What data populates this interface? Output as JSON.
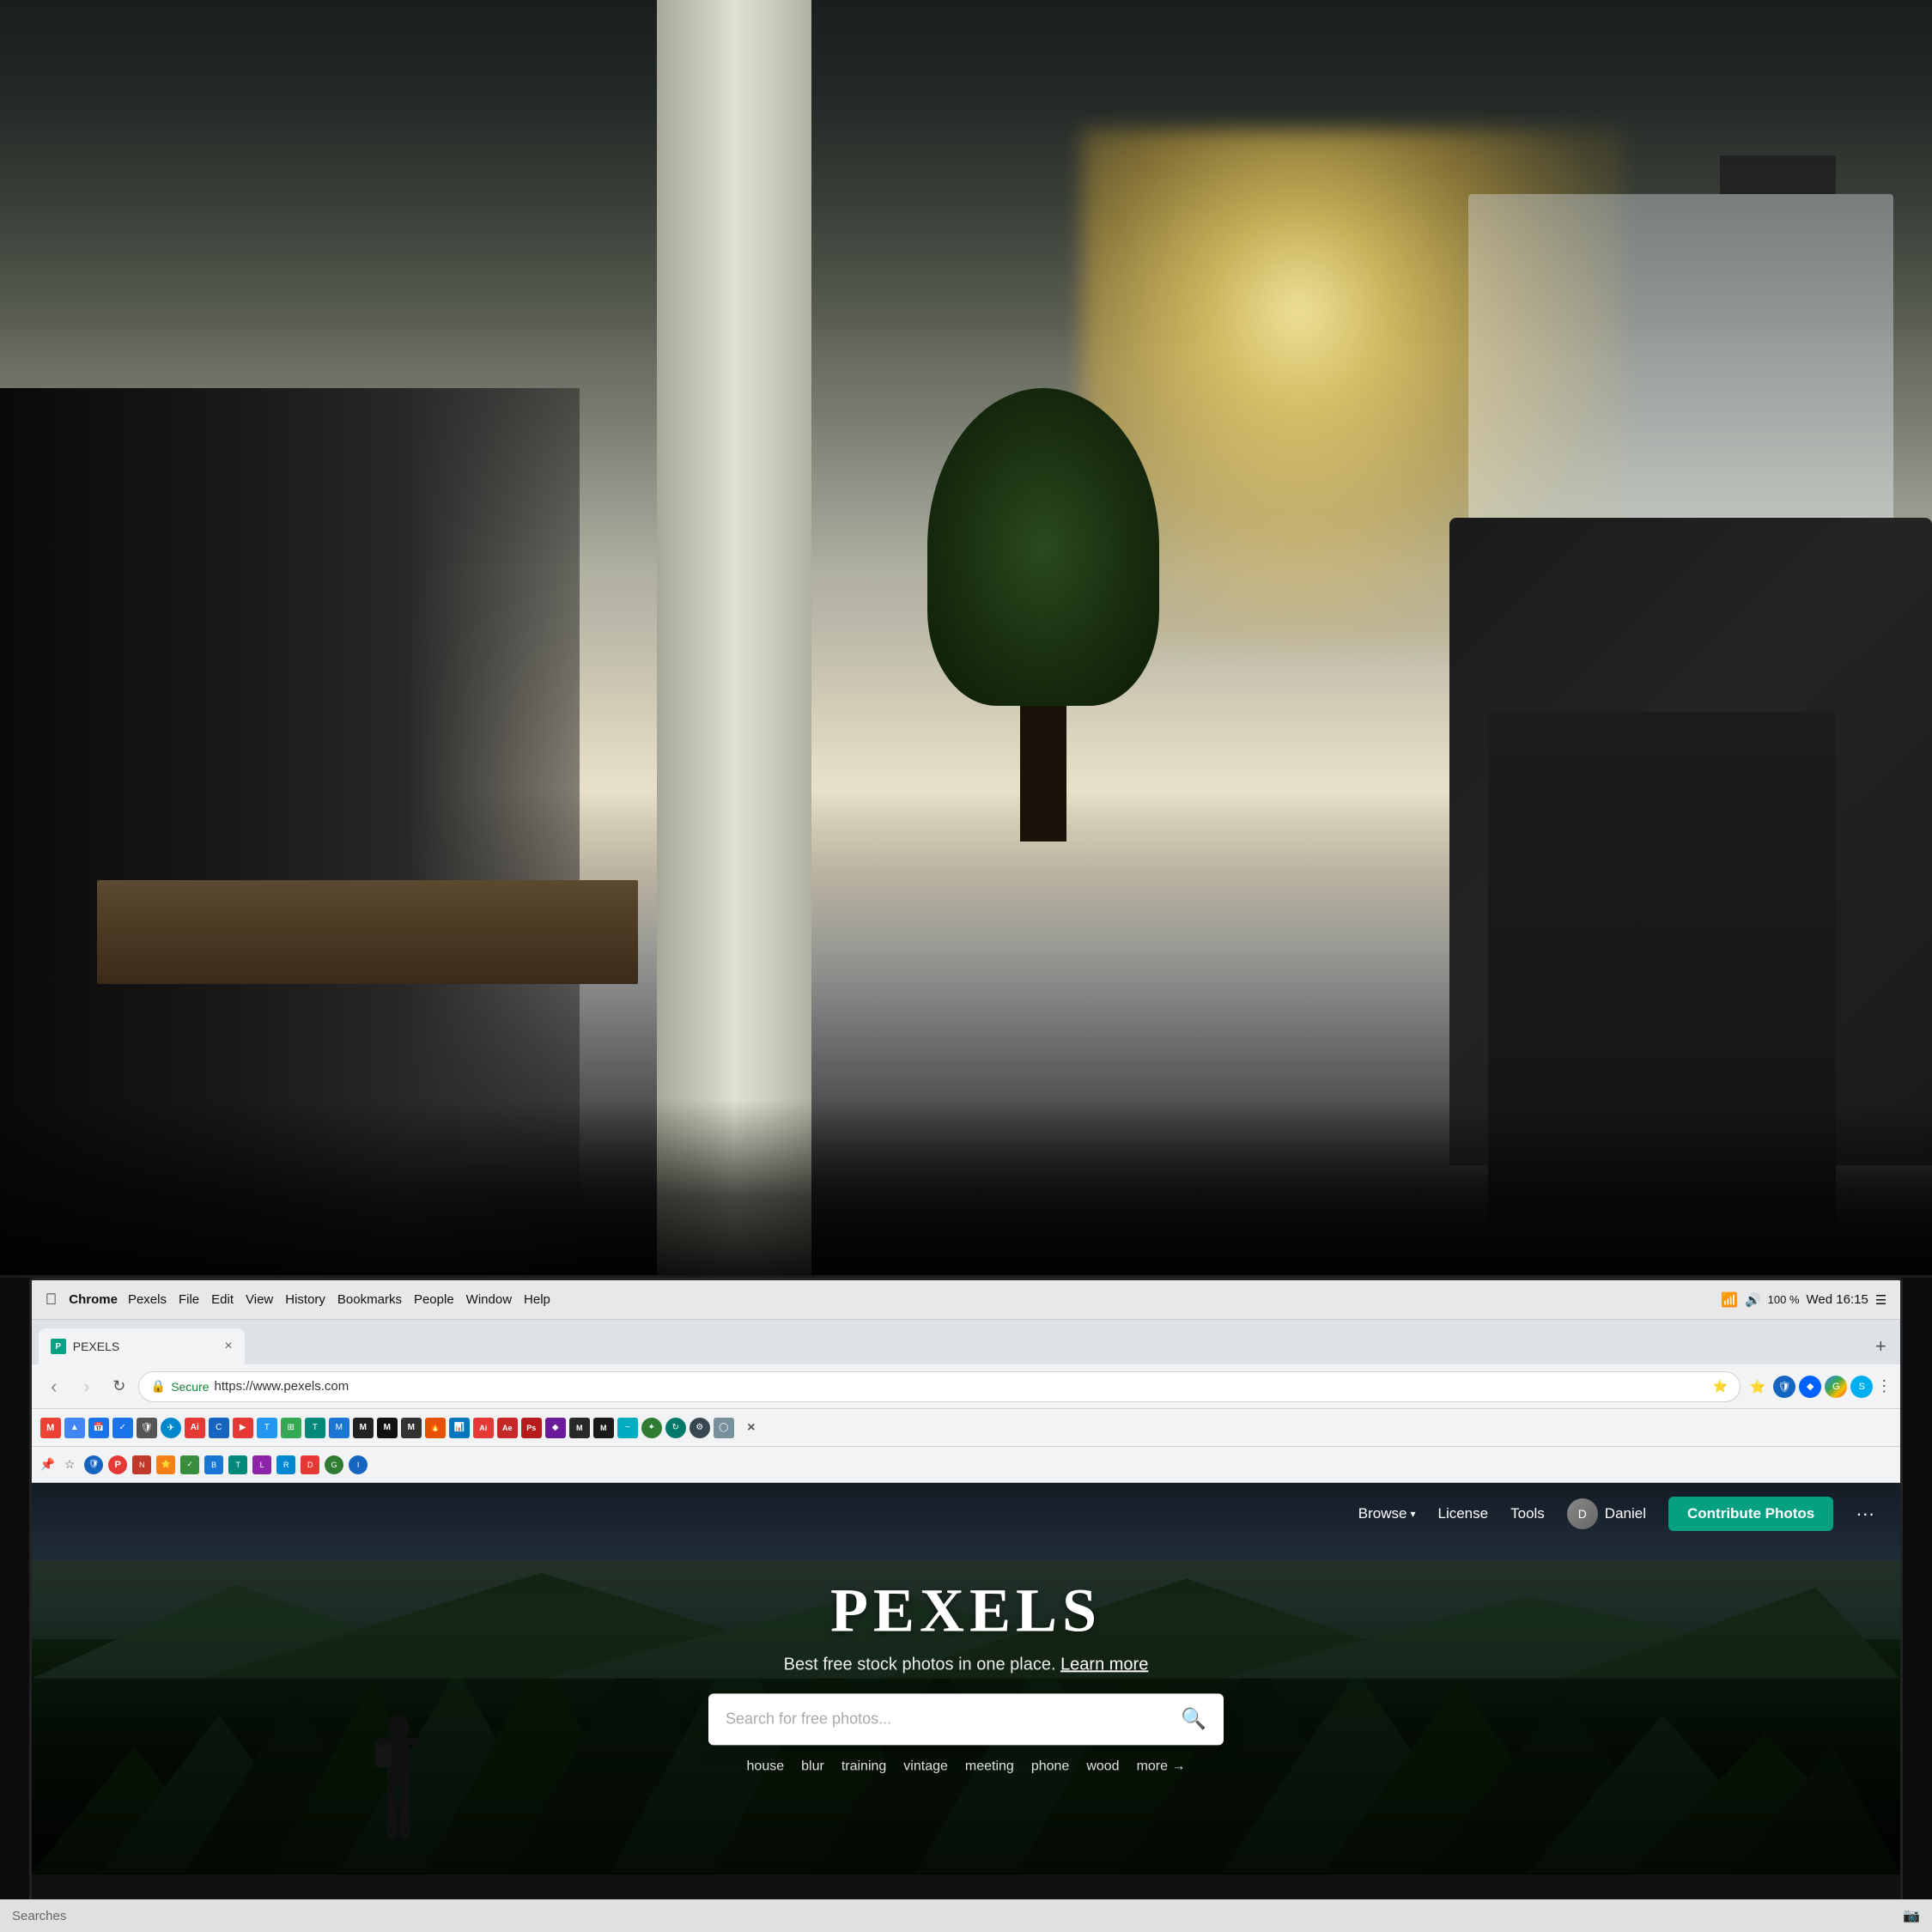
{
  "background": {
    "description": "Office interior background photo with blurred bokeh lights"
  },
  "macos": {
    "menubar": {
      "app": "Chrome",
      "menus": [
        "File",
        "Edit",
        "View",
        "History",
        "Bookmarks",
        "People",
        "Window",
        "Help"
      ],
      "time": "Wed 16:15",
      "battery": "100 %"
    }
  },
  "browser": {
    "tab": {
      "favicon_label": "P",
      "title": "Pexels",
      "close_label": "×"
    },
    "toolbar": {
      "back_label": "‹",
      "forward_label": "›",
      "reload_label": "↻",
      "secure_label": "Secure",
      "url": "https://www.pexels.com",
      "more_label": "⋮"
    }
  },
  "pexels": {
    "nav": {
      "browse_label": "Browse",
      "license_label": "License",
      "tools_label": "Tools",
      "user_name": "Daniel",
      "contribute_label": "Contribute Photos",
      "more_label": "···"
    },
    "hero": {
      "logo": "PEXELS",
      "tagline": "Best free stock photos in one place.",
      "learn_more": "Learn more",
      "search_placeholder": "Search for free photos...",
      "suggestions": [
        "house",
        "blur",
        "training",
        "vintage",
        "meeting",
        "phone",
        "wood"
      ],
      "more_label": "more →"
    }
  },
  "taskbar": {
    "status": "Searches"
  },
  "colors": {
    "contribute_btn": "#05a081",
    "pexels_green": "#05a081",
    "dark_bg": "#0d0d0d",
    "hero_overlay": "rgba(0,0,0,0.4)"
  }
}
